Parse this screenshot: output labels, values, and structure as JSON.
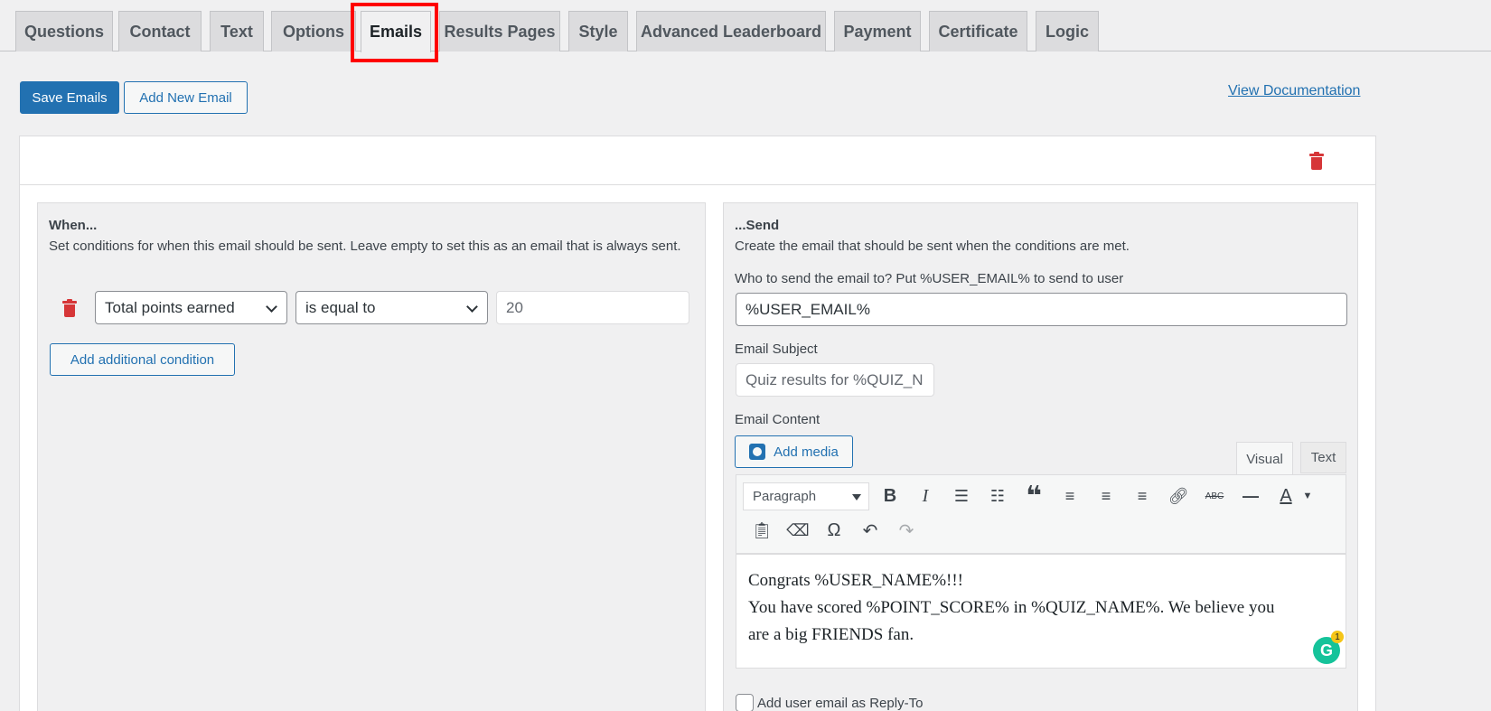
{
  "tabs": [
    {
      "label": "Questions"
    },
    {
      "label": "Contact"
    },
    {
      "label": "Text"
    },
    {
      "label": "Options"
    },
    {
      "label": "Emails"
    },
    {
      "label": "Results Pages"
    },
    {
      "label": "Style"
    },
    {
      "label": "Advanced Leaderboard"
    },
    {
      "label": "Payment"
    },
    {
      "label": "Certificate"
    },
    {
      "label": "Logic"
    }
  ],
  "active_tab": "Emails",
  "toolbar": {
    "save_label": "Save Emails",
    "add_label": "Add New Email",
    "doc_link": "View Documentation"
  },
  "when": {
    "title": "When...",
    "description": "Set conditions for when this email should be sent. Leave empty to set this as an email that is always sent.",
    "condition": {
      "field": "Total points earned",
      "operator": "is equal to",
      "value": "20"
    },
    "add_condition_label": "Add additional condition"
  },
  "send": {
    "title": "...Send",
    "description": "Create the email that should be sent when the conditions are met.",
    "to_label": "Who to send the email to? Put %USER_EMAIL% to send to user",
    "to_value": "%USER_EMAIL%",
    "subject_label": "Email Subject",
    "subject_value": "Quiz results for %QUIZ_N",
    "content_label": "Email Content",
    "add_media_label": "Add media",
    "editor_tabs": {
      "visual": "Visual",
      "text": "Text"
    },
    "format_select": "Paragraph",
    "content_lines": [
      "Congrats %USER_NAME%!!!",
      "You have scored %POINT_SCORE% in %QUIZ_NAME%. We believe you",
      "are a big FRIENDS fan."
    ],
    "grammarly_count": "1",
    "reply_to_label": "Add user email as Reply-To"
  },
  "colors": {
    "primary": "#2271b1",
    "danger": "#d63638",
    "highlight": "#ff0000"
  }
}
